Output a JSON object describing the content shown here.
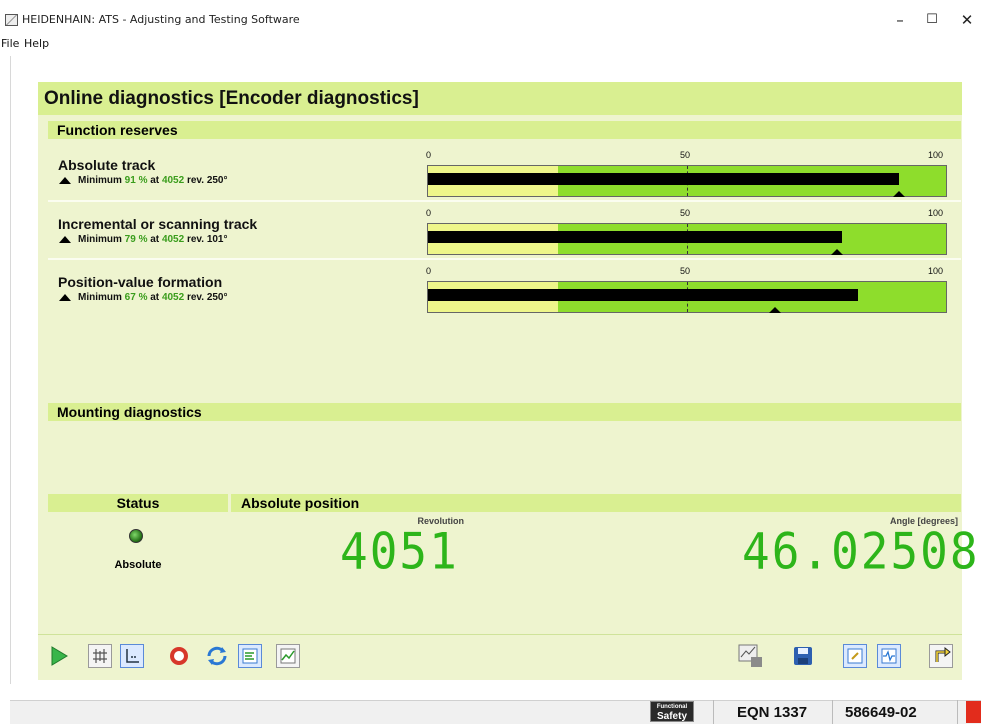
{
  "window": {
    "title": "HEIDENHAIN: ATS - Adjusting and Testing Software",
    "minimize": "–",
    "maximize": "☐",
    "close": "✕"
  },
  "menu": {
    "items": [
      "File",
      "Help"
    ]
  },
  "page_title": "Online diagnostics [Encoder diagnostics]",
  "function_reserves": {
    "heading": "Function reserves",
    "scale": {
      "min": "0",
      "mid": "50",
      "max": "100"
    },
    "rows": [
      {
        "title": "Absolute track",
        "minimum_label": "Minimum",
        "pct": "91 %",
        "at": "at",
        "rev": "4052",
        "rev_label": "rev.",
        "angle": "250°",
        "bar_value": 91,
        "min_value": 91
      },
      {
        "title": "Incremental or scanning track",
        "minimum_label": "Minimum",
        "pct": "79 %",
        "at": "at",
        "rev": "4052",
        "rev_label": "rev.",
        "angle": "101°",
        "bar_value": 80,
        "min_value": 79
      },
      {
        "title": "Position-value formation",
        "minimum_label": "Minimum",
        "pct": "67 %",
        "at": "at",
        "rev": "4052",
        "rev_label": "rev.",
        "angle": "250°",
        "bar_value": 83,
        "min_value": 67
      }
    ]
  },
  "mounting": {
    "heading": "Mounting diagnostics"
  },
  "status": {
    "heading": "Status",
    "value": "Absolute",
    "led_color": "#2db51a"
  },
  "absolute_position": {
    "heading": "Absolute position",
    "revolution_label": "Revolution",
    "revolution_value": "4051",
    "angle_label": "Angle [degrees]",
    "angle_value": "46.02508"
  },
  "toolbar": {
    "left": [
      "play-icon",
      "grid-icon",
      "axis-icon",
      "zoom-icon",
      "refresh-icon",
      "list-icon",
      "chart-icon"
    ],
    "right": [
      "export-icon",
      "save-icon",
      "edit-icon",
      "wave-icon",
      "back-icon"
    ]
  },
  "statusbar": {
    "safety_top": "Functional",
    "safety_bottom": "Safety",
    "device": "EQN 1337",
    "id": "586649-02"
  },
  "colors": {
    "header": "#d9ef91",
    "panel": "#eef4cf",
    "accent_green": "#3a9d1c",
    "lcd": "#2db51a",
    "gauge_green": "#8edd2c",
    "gauge_yellow": "#eef68a"
  }
}
